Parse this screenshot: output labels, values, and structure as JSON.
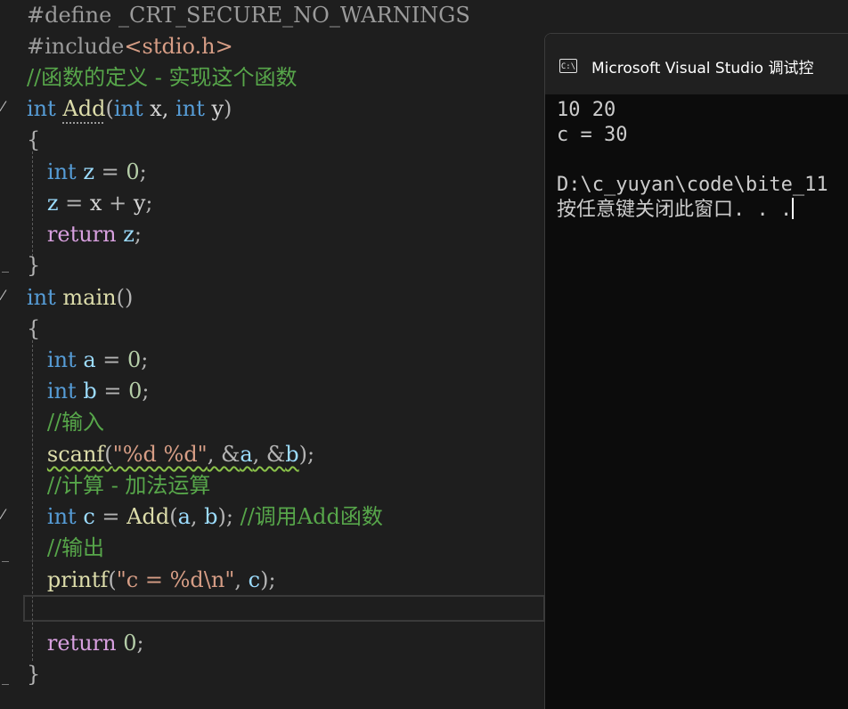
{
  "editor": {
    "lines": [
      {
        "tokens": [
          {
            "c": "pp",
            "t": "#define "
          },
          {
            "c": "pp",
            "t": "_CRT_SECURE_NO_WARNINGS"
          }
        ]
      },
      {
        "tokens": [
          {
            "c": "pp",
            "t": "#include"
          },
          {
            "c": "inc",
            "t": "<stdio.h>"
          }
        ]
      },
      {
        "tokens": [
          {
            "c": "cmt",
            "t": "//函数的定义 - 实现这个函数"
          }
        ]
      },
      {
        "tokens": [
          {
            "c": "kw",
            "t": "int"
          },
          {
            "c": "",
            "t": " "
          },
          {
            "c": "fn dots",
            "t": "Add"
          },
          {
            "c": "op",
            "t": "("
          },
          {
            "c": "kw",
            "t": "int"
          },
          {
            "c": "",
            "t": " x, "
          },
          {
            "c": "kw",
            "t": "int"
          },
          {
            "c": "",
            "t": " y"
          },
          {
            "c": "op",
            "t": ")"
          }
        ]
      },
      {
        "tokens": [
          {
            "c": "op",
            "t": "{"
          }
        ]
      },
      {
        "tokens": [
          {
            "c": "",
            "t": "   "
          },
          {
            "c": "kw",
            "t": "int"
          },
          {
            "c": "",
            "t": " "
          },
          {
            "c": "var",
            "t": "z"
          },
          {
            "c": "op",
            "t": " = "
          },
          {
            "c": "num",
            "t": "0"
          },
          {
            "c": "op",
            "t": ";"
          }
        ]
      },
      {
        "tokens": [
          {
            "c": "",
            "t": "   "
          },
          {
            "c": "var",
            "t": "z"
          },
          {
            "c": "op",
            "t": " = "
          },
          {
            "c": "",
            "t": "x"
          },
          {
            "c": "op",
            "t": " + "
          },
          {
            "c": "",
            "t": "y"
          },
          {
            "c": "op",
            "t": ";"
          }
        ]
      },
      {
        "tokens": [
          {
            "c": "",
            "t": "   "
          },
          {
            "c": "ctl",
            "t": "return"
          },
          {
            "c": "",
            "t": " "
          },
          {
            "c": "var",
            "t": "z"
          },
          {
            "c": "op",
            "t": ";"
          }
        ]
      },
      {
        "tokens": [
          {
            "c": "op",
            "t": "}"
          }
        ]
      },
      {
        "tokens": [
          {
            "c": "kw",
            "t": "int"
          },
          {
            "c": "",
            "t": " "
          },
          {
            "c": "fn",
            "t": "main"
          },
          {
            "c": "op",
            "t": "()"
          }
        ]
      },
      {
        "tokens": [
          {
            "c": "op",
            "t": "{"
          }
        ]
      },
      {
        "tokens": [
          {
            "c": "",
            "t": "   "
          },
          {
            "c": "kw",
            "t": "int"
          },
          {
            "c": "",
            "t": " "
          },
          {
            "c": "var",
            "t": "a"
          },
          {
            "c": "op",
            "t": " = "
          },
          {
            "c": "num",
            "t": "0"
          },
          {
            "c": "op",
            "t": ";"
          }
        ]
      },
      {
        "tokens": [
          {
            "c": "",
            "t": "   "
          },
          {
            "c": "kw",
            "t": "int"
          },
          {
            "c": "",
            "t": " "
          },
          {
            "c": "var",
            "t": "b"
          },
          {
            "c": "op",
            "t": " = "
          },
          {
            "c": "num",
            "t": "0"
          },
          {
            "c": "op",
            "t": ";"
          }
        ]
      },
      {
        "tokens": [
          {
            "c": "",
            "t": "   "
          },
          {
            "c": "cmt",
            "t": "//输入"
          }
        ]
      },
      {
        "tokens": [
          {
            "c": "",
            "t": "   "
          },
          {
            "c": "fn squig",
            "t": "scanf"
          },
          {
            "c": "op squig",
            "t": "("
          },
          {
            "c": "str squig",
            "t": "\"%d %d\""
          },
          {
            "c": "op squig",
            "t": ", &"
          },
          {
            "c": "var squig",
            "t": "a"
          },
          {
            "c": "op squig",
            "t": ", &"
          },
          {
            "c": "var squig",
            "t": "b"
          },
          {
            "c": "op",
            "t": ");"
          }
        ]
      },
      {
        "tokens": [
          {
            "c": "",
            "t": "   "
          },
          {
            "c": "cmt",
            "t": "//计算 - 加法运算"
          }
        ]
      },
      {
        "tokens": [
          {
            "c": "",
            "t": "   "
          },
          {
            "c": "kw",
            "t": "int"
          },
          {
            "c": "",
            "t": " "
          },
          {
            "c": "var",
            "t": "c"
          },
          {
            "c": "op",
            "t": " = "
          },
          {
            "c": "fn",
            "t": "Add"
          },
          {
            "c": "op",
            "t": "("
          },
          {
            "c": "var",
            "t": "a"
          },
          {
            "c": "op",
            "t": ", "
          },
          {
            "c": "var",
            "t": "b"
          },
          {
            "c": "op",
            "t": "); "
          },
          {
            "c": "cmt",
            "t": "//调用Add函数"
          }
        ]
      },
      {
        "tokens": [
          {
            "c": "",
            "t": "   "
          },
          {
            "c": "cmt",
            "t": "//输出"
          }
        ]
      },
      {
        "tokens": [
          {
            "c": "",
            "t": "   "
          },
          {
            "c": "fn",
            "t": "printf"
          },
          {
            "c": "op",
            "t": "("
          },
          {
            "c": "str",
            "t": "\"c = %d\\n\""
          },
          {
            "c": "op",
            "t": ", "
          },
          {
            "c": "var",
            "t": "c"
          },
          {
            "c": "op",
            "t": ");"
          }
        ]
      },
      {
        "tokens": [
          {
            "c": "",
            "t": ""
          }
        ]
      },
      {
        "tokens": [
          {
            "c": "",
            "t": "   "
          },
          {
            "c": "ctl",
            "t": "return"
          },
          {
            "c": "",
            "t": " "
          },
          {
            "c": "num",
            "t": "0"
          },
          {
            "c": "op",
            "t": ";"
          }
        ]
      },
      {
        "tokens": [
          {
            "c": "op",
            "t": "}"
          }
        ]
      }
    ]
  },
  "console": {
    "title": "Microsoft Visual Studio 调试控",
    "icon": "cmd-icon",
    "icon_text": "C:\\",
    "output": [
      "10 20",
      "c = 30",
      "",
      "D:\\c_yuyan\\code\\bite_11",
      "按任意键关闭此窗口. . ."
    ]
  },
  "colors": {
    "background": "#1e1e1e",
    "keyword": "#569cd6",
    "function": "#dcdcaa",
    "comment": "#57a64a",
    "string": "#d69d85",
    "console_background": "#0c0c0c"
  }
}
